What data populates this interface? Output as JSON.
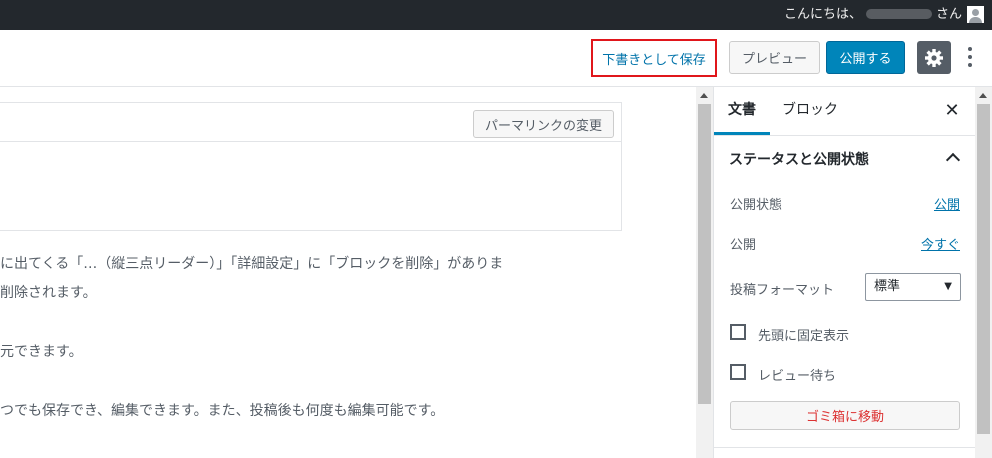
{
  "adminbar": {
    "greeting_prefix": "こんにちは、",
    "greeting_suffix": "さん"
  },
  "header": {
    "save_draft_label": "下書きとして保存",
    "preview_label": "プレビュー",
    "publish_label": "公開する"
  },
  "content": {
    "permalink_button_label": "パーマリンクの変更",
    "paragraphs": [
      "に出てくる「…（縦三点リーダー）」「詳細設定」に「ブロックを削除」がありま",
      "削除されます。",
      "元できます。",
      "つでも保存でき、編集できます。また、投稿後も何度も編集可能です。"
    ]
  },
  "sidebar": {
    "tabs": [
      "文書",
      "ブロック"
    ],
    "panel_title": "ステータスと公開状態",
    "visibility_label": "公開状態",
    "visibility_value": "公開",
    "publish_label": "公開",
    "publish_value": "今すぐ",
    "format_label": "投稿フォーマット",
    "format_value": "標準",
    "sticky_label": "先頭に固定表示",
    "pending_label": "レビュー待ち",
    "trash_label": "ゴミ箱に移動"
  },
  "colors": {
    "accent": "#0085ba",
    "highlight": "#e0161b",
    "adminbar": "#23282d",
    "danger": "#dc3232"
  }
}
